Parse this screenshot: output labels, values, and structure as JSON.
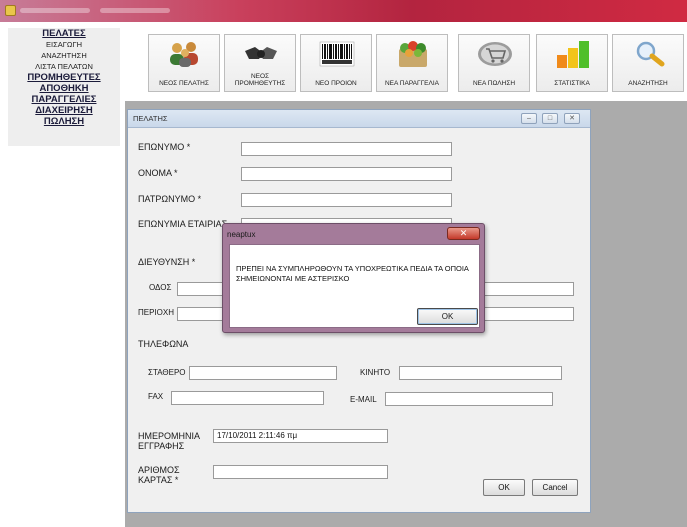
{
  "menu": {
    "items": [
      {
        "label": "ΠΕΛΑΤΕΣ",
        "kind": "main"
      },
      {
        "label": "ΕΙΣΑΓΩΓΗ",
        "kind": "sub"
      },
      {
        "label": "ΑΝΑΖΗΤΗΣΗ",
        "kind": "sub"
      },
      {
        "label": "ΛΙΣΤΑ ΠΕΛΑΤΩΝ",
        "kind": "sub"
      },
      {
        "label": "ΠΡΟΜΗΘΕΥΤΕΣ",
        "kind": "main"
      },
      {
        "label": "ΑΠΟΘΗΚΗ",
        "kind": "main"
      },
      {
        "label": "ΠΑΡΑΓΓΕΛΙΕΣ",
        "kind": "main"
      },
      {
        "label": "ΔΙΑΧΕΙΡΗΣΗ",
        "kind": "main"
      },
      {
        "label": "ΠΩΛΗΣΗ",
        "kind": "main"
      }
    ]
  },
  "toolbar": {
    "items": [
      {
        "label": "ΝΕΟΣ ΠΕΛΑΤΗΣ",
        "icon": "customers-icon"
      },
      {
        "label": "ΝΕΟΣ ΠΡΟΜΗΘΕΥΤΗΣ",
        "icon": "handshake-icon"
      },
      {
        "label": "ΝΕΟ ΠΡΟΙΟΝ",
        "icon": "barcode-icon"
      },
      {
        "label": "ΝΕΑ ΠΑΡΑΓΓΕΛΙΑ",
        "icon": "grocery-icon"
      },
      {
        "label": "ΝΕΑ ΠΩΛΗΣΗ",
        "icon": "cart-icon"
      },
      {
        "label": "ΣΤΑΤΙΣΤΙΚΑ",
        "icon": "bar-chart-icon"
      },
      {
        "label": "ΑΝΑΖΗΤΗΣΗ",
        "icon": "magnifier-icon"
      }
    ]
  },
  "form": {
    "title": "ΠΕΛΑΤΗΣ",
    "surname_label": "ΕΠΩΝΥΜΟ *",
    "name_label": "ΟΝΟΜΑ *",
    "father_label": "ΠΑΤΡΩΝΥΜΟ *",
    "company_label": "ΕΠΩΝΥΜΙΑ ΕΤΑΙΡΙΑΣ",
    "address_label": "ΔΙΕΥΘΥΝΣΗ *",
    "street_label": "ΟΔΟΣ",
    "area_label": "ΠΕΡΙΟΧΗ",
    "phones_label": "ΤΗΛΕΦΩΝΑ",
    "landline_label": "ΣΤΑΘΕΡΟ",
    "mobile_label": "ΚΙΝΗΤΟ",
    "fax_label": "FAX",
    "email_label": "E-MAIL",
    "regdate_label": "ΗΜΕΡΟΜΗΝΙΑ ΕΓΓΡΑΦΗΣ",
    "regdate_value": "17/10/2011 2:11:46 πμ",
    "card_label": "ΑΡΙΘΜΟΣ ΚΑΡΤΑΣ *",
    "ok_label": "OK",
    "cancel_label": "Cancel"
  },
  "dialog": {
    "title": "neaptux",
    "message": "ΠΡΕΠΕΙ ΝΑ ΣΥΜΠΛΗΡΩΘΟΥΝ ΤΑ ΥΠΟΧΡΕΩΤΙΚΑ ΠΕΔΙΑ ΤΑ ΟΠΟΙΑ ΣΗΜΕΙΩΝΟΝΤΑΙ ΜΕ ΑΣΤΕΡΙΣΚΟ",
    "ok_label": "OK",
    "close_glyph": "✕"
  },
  "colors": {
    "titlebar": "#c9405c",
    "workspace": "#ababab",
    "menu_bg": "#eeeeee",
    "dialog_frame": "#a47b9a"
  }
}
